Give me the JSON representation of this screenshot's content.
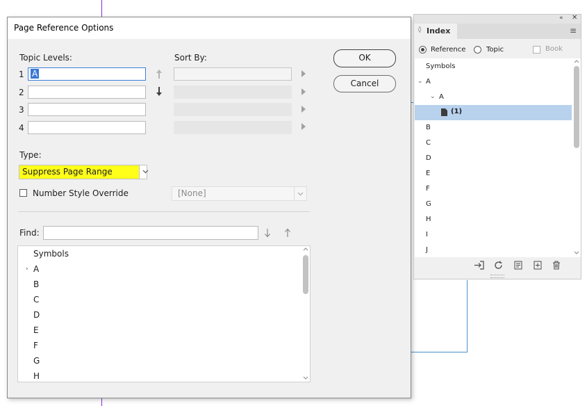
{
  "dialog": {
    "title": "Page Reference Options",
    "topic_levels_label": "Topic Levels:",
    "sort_by_label": "Sort By:",
    "level_numbers": [
      "1",
      "2",
      "3",
      "4"
    ],
    "level1_value": "A",
    "ok_label": "OK",
    "cancel_label": "Cancel",
    "type_label": "Type:",
    "type_value": "Suppress Page Range",
    "number_style_label": "Number Style Override",
    "number_style_value": "[None]",
    "find_label": "Find:",
    "list_items": [
      "Symbols",
      "A",
      "B",
      "C",
      "D",
      "E",
      "F",
      "G",
      "H"
    ]
  },
  "panel": {
    "title": "Index",
    "radio_reference": "Reference",
    "radio_topic": "Topic",
    "book_label": "Book",
    "tree": {
      "symbols": "Symbols",
      "a_top": "A",
      "a_sub": "A",
      "page_ref": "(1)",
      "letters": [
        "B",
        "C",
        "D",
        "E",
        "F",
        "G",
        "H",
        "I",
        "J"
      ]
    }
  },
  "colors": {
    "highlight": "#ffff1a",
    "selection": "#b8d2ee",
    "focus": "#3c7fd8"
  }
}
